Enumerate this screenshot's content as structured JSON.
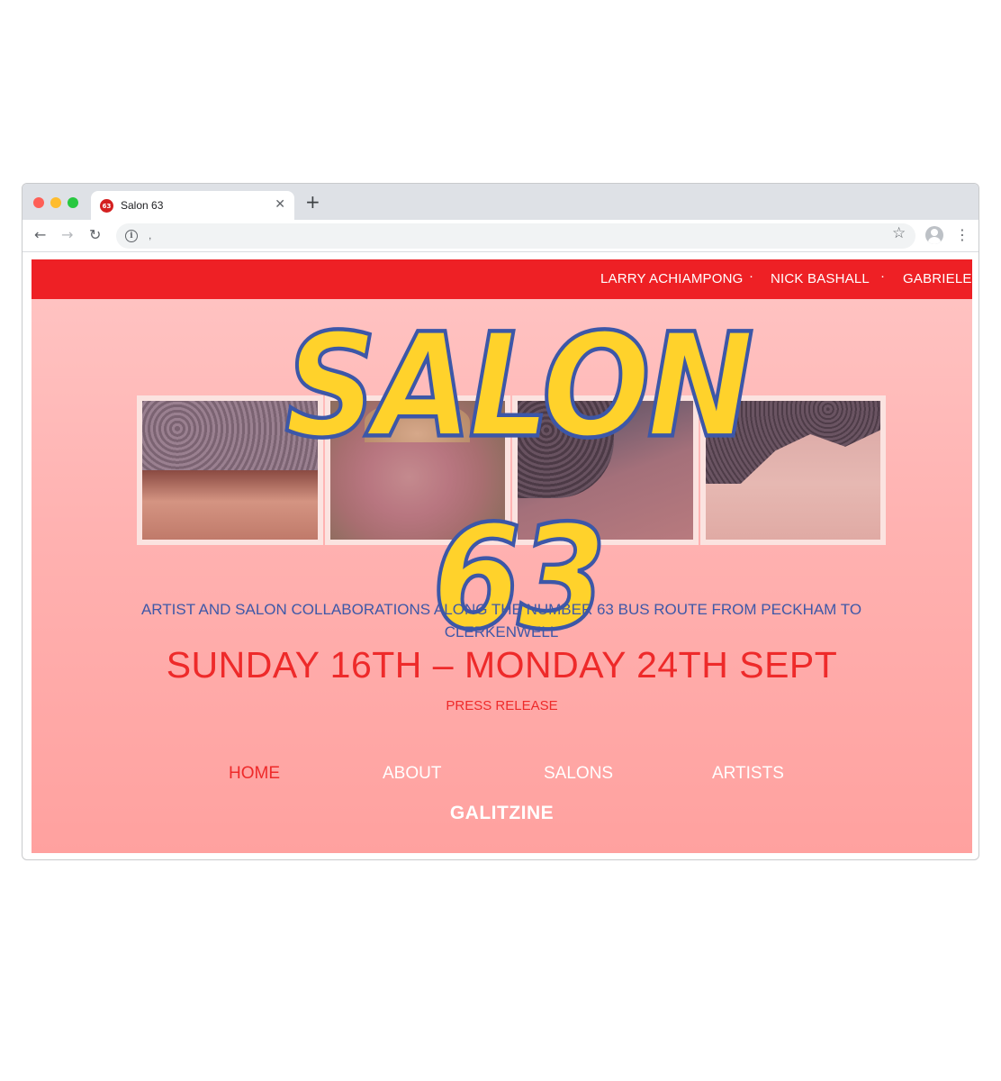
{
  "browser": {
    "tab_title": "Salon 63",
    "tab_favicon_text": "63",
    "tab_close": "✕",
    "new_tab": "+",
    "url": ",",
    "nav": {
      "back": "←",
      "forward": "→",
      "reload": "↻",
      "info": "i",
      "bookmark": "☆",
      "menu": "⋮"
    }
  },
  "site": {
    "ticker": [
      "LARRY ACHIAMPONG",
      "NICK BASHALL",
      "GABRIELE B"
    ],
    "ticker_separator": "·",
    "logo": "SALON 63",
    "tagline": "ARTIST AND SALON COLLABORATIONS ALONG THE NUMBER 63 BUS ROUTE FROM PECKHAM TO CLERKENWELL",
    "dates": "SUNDAY 16TH – MONDAY 24TH SEPT",
    "press_release": "PRESS RELEASE",
    "menu": [
      {
        "label": "HOME",
        "active": true
      },
      {
        "label": "ABOUT",
        "active": false
      },
      {
        "label": "SALONS",
        "active": false
      },
      {
        "label": "ARTISTS",
        "active": false
      }
    ],
    "sponsor": "GALITZINE"
  },
  "colors": {
    "ticker_bg": "#ee2020",
    "logo_fill": "#ffd22b",
    "logo_outline": "#3c57a8",
    "accent_red": "#ee2a2a",
    "tagline_blue": "#3e58a8"
  }
}
